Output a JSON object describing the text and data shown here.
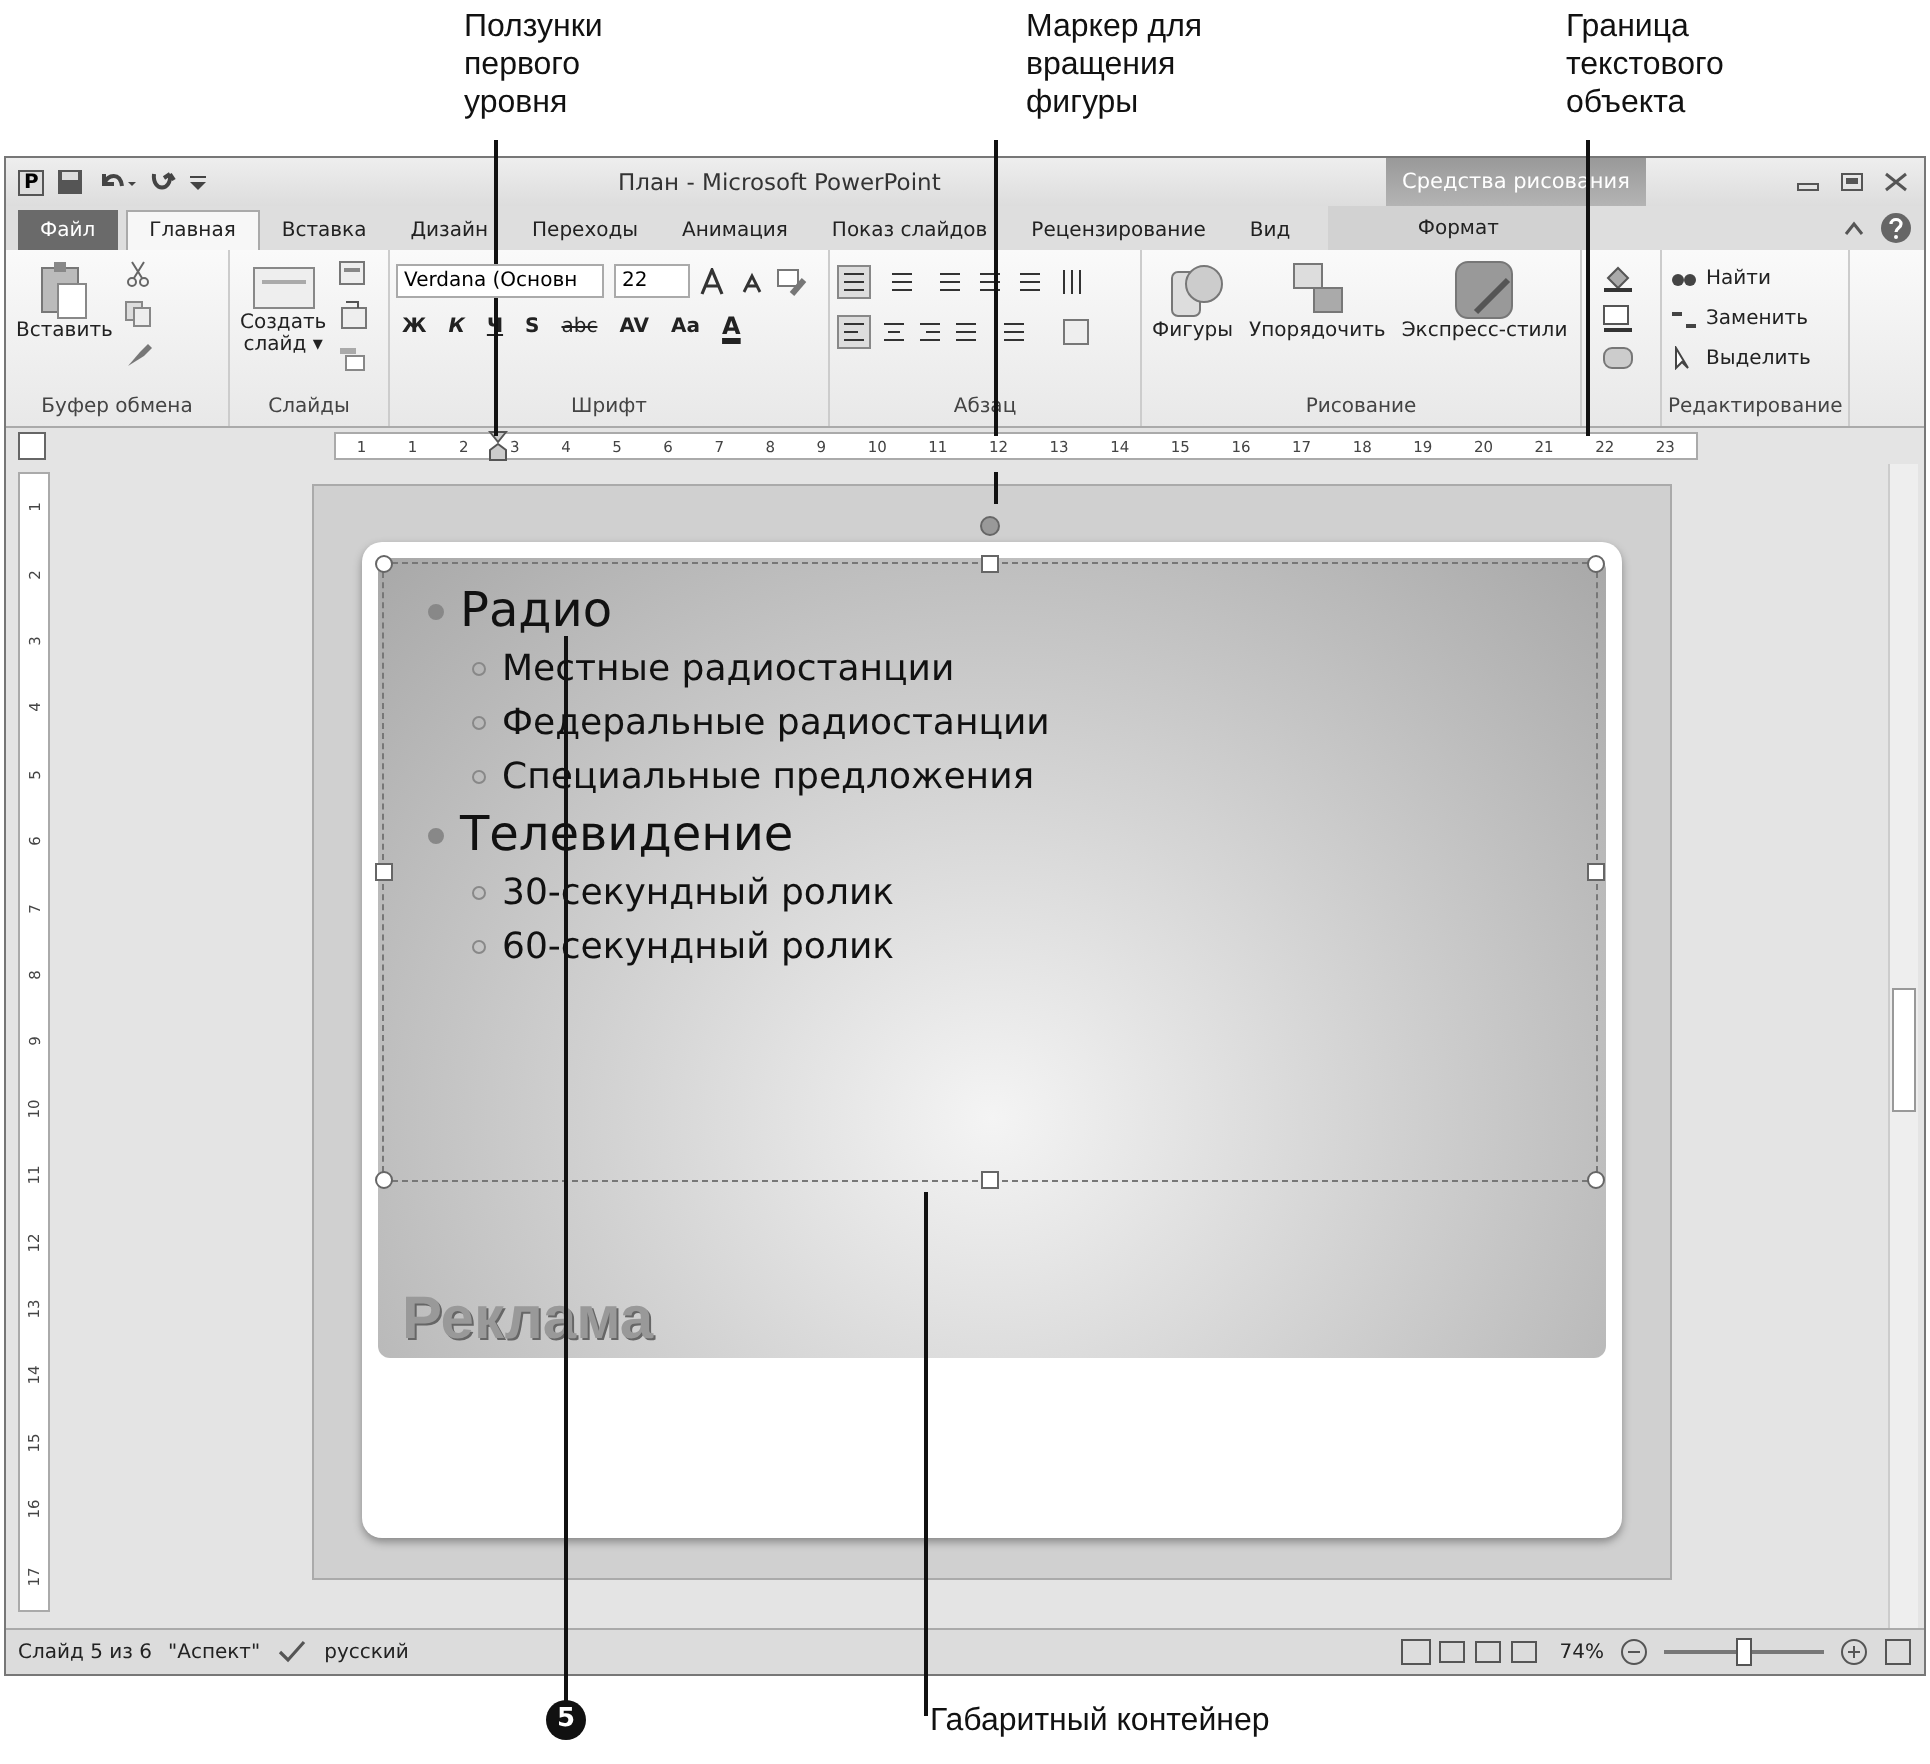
{
  "callouts": [
    {
      "kind": "top",
      "text": "Ползунки\nпервого\nуровня"
    },
    {
      "kind": "top",
      "text": "Маркер для\nвращения\nфигуры"
    },
    {
      "kind": "top",
      "text": "Граница\nтекстового\nобъекта"
    },
    {
      "kind": "number",
      "text": "5"
    },
    {
      "kind": "bottom",
      "text": "Габаритный контейнер"
    }
  ],
  "window": {
    "app_icon": "P",
    "title": "План - Microsoft PowerPoint",
    "context_label": "Средства рисования"
  },
  "tabs": [
    {
      "label": "Файл",
      "kind": "file",
      "selected": false
    },
    {
      "label": "Главная",
      "kind": "tab",
      "selected": true
    },
    {
      "label": "Вставка",
      "kind": "tab",
      "selected": false
    },
    {
      "label": "Дизайн",
      "kind": "tab",
      "selected": false
    },
    {
      "label": "Переходы",
      "kind": "tab",
      "selected": false
    },
    {
      "label": "Анимация",
      "kind": "tab",
      "selected": false
    },
    {
      "label": "Показ слайдов",
      "kind": "tab",
      "selected": false
    },
    {
      "label": "Рецензирование",
      "kind": "tab",
      "selected": false
    },
    {
      "label": "Вид",
      "kind": "tab",
      "selected": false
    },
    {
      "label": "Формат",
      "kind": "context",
      "selected": false
    }
  ],
  "ribbon": {
    "clipboard": {
      "paste": "Вставить",
      "label": "Буфер обмена"
    },
    "slides": {
      "new_slide": "Создать\nслайд ▾",
      "label": "Слайды"
    },
    "font": {
      "font_name": "Verdana (Основн",
      "font_size": "22",
      "buttons": [
        "Ж",
        "К",
        "Ч",
        "S",
        "abc",
        "AV",
        "Aa"
      ],
      "color_button": "A",
      "label": "Шрифт"
    },
    "paragraph": {
      "label": "Абзац"
    },
    "drawing": {
      "buttons": [
        "Фигуры",
        "Упорядочить",
        "Экспресс-стили"
      ],
      "label": "Рисование"
    },
    "editing": {
      "buttons": [
        "Найти",
        "Заменить",
        "Выделить"
      ],
      "label": "Редактирование"
    }
  },
  "ruler": {
    "h_labels": [
      "1",
      "1",
      "2",
      "3",
      "4",
      "5",
      "6",
      "7",
      "8",
      "9",
      "10",
      "11",
      "12",
      "13",
      "14",
      "15",
      "16",
      "17",
      "18",
      "19",
      "20",
      "21",
      "22",
      "23"
    ],
    "v_labels": [
      "1",
      "2",
      "3",
      "4",
      "5",
      "6",
      "7",
      "8",
      "9",
      "10",
      "11",
      "12",
      "13",
      "14",
      "15",
      "16",
      "17"
    ]
  },
  "slide": {
    "bullets": [
      {
        "text": "Радио",
        "children": [
          {
            "text": "Местные радиостанции"
          },
          {
            "text": "Федеральные радиостанции"
          },
          {
            "text": "Специальные предложения"
          }
        ]
      },
      {
        "text": "Телевидение",
        "children": [
          {
            "text": "30-секундный ролик"
          },
          {
            "text": "60-секундный ролик"
          }
        ]
      }
    ],
    "title": "Реклама"
  },
  "status_bar": {
    "slide": "Слайд 5 из 6",
    "theme": "\"Аспект\"",
    "language": "русский",
    "zoom": "74%",
    "zoom_slider": {
      "level": 0.5
    }
  }
}
